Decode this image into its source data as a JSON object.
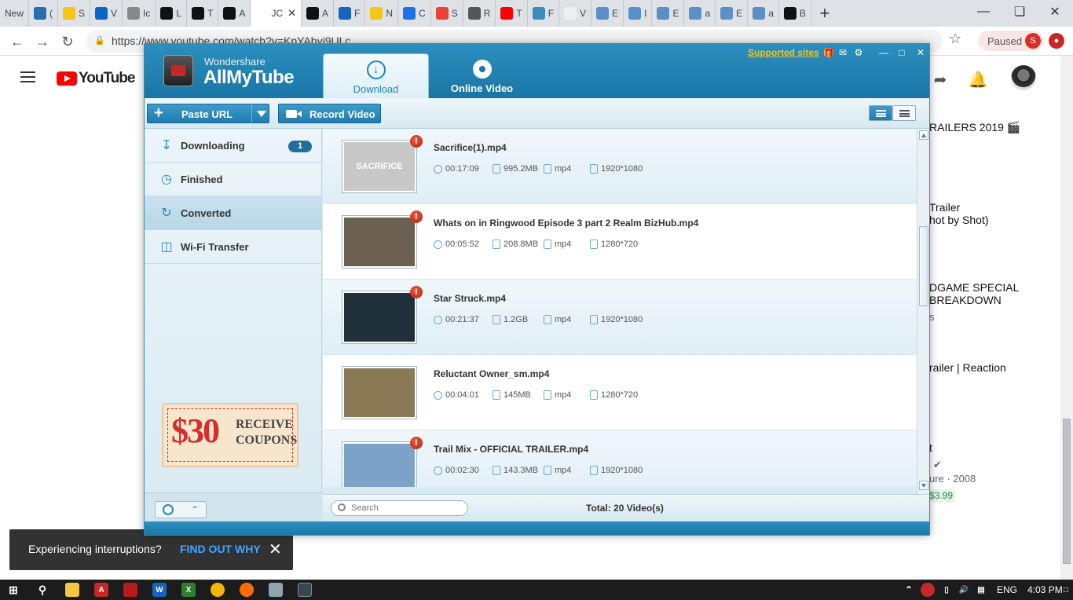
{
  "browser": {
    "tabs": [
      {
        "label": "New",
        "icon": "new-tab-icon",
        "color": "#dee1e6"
      },
      {
        "label": "(",
        "icon": "globe-icon",
        "color": "#2b6cb0"
      },
      {
        "label": "S",
        "icon": "imdb-icon",
        "color": "#f5c518"
      },
      {
        "label": "V",
        "icon": "linkedin-icon",
        "color": "#0a66c2"
      },
      {
        "label": "Ic",
        "icon": "doc-icon",
        "color": "#888888"
      },
      {
        "label": "L",
        "icon": "a-icon",
        "color": "#111111"
      },
      {
        "label": "T",
        "icon": "a-icon",
        "color": "#111111"
      },
      {
        "label": "A",
        "icon": "a-icon",
        "color": "#111111"
      },
      {
        "label": "JC",
        "icon": "jc-icon",
        "color": "#ffffff",
        "active": true
      },
      {
        "label": "A",
        "icon": "a-icon",
        "color": "#111111"
      },
      {
        "label": "F",
        "icon": "f-icon",
        "color": "#1565c0"
      },
      {
        "label": "N",
        "icon": "pencil-icon",
        "color": "#f5c518"
      },
      {
        "label": "C",
        "icon": "calendar-icon",
        "color": "#1a73e8"
      },
      {
        "label": "S",
        "icon": "google-icon",
        "color": "#ea4335"
      },
      {
        "label": "R",
        "icon": "wikipedia-icon",
        "color": "#555555"
      },
      {
        "label": "T",
        "icon": "youtube-icon",
        "color": "#ff0000"
      },
      {
        "label": "F",
        "icon": "puzzle-icon",
        "color": "#3c8dbc"
      },
      {
        "label": "V",
        "icon": "plesk-icon",
        "color": "#eeeeee"
      },
      {
        "label": "E",
        "icon": "wo-icon",
        "color": "#5b8fc7"
      },
      {
        "label": "I",
        "icon": "wo-icon",
        "color": "#5b8fc7"
      },
      {
        "label": "E",
        "icon": "wo-icon",
        "color": "#5b8fc7"
      },
      {
        "label": "a",
        "icon": "wo-icon",
        "color": "#5b8fc7"
      },
      {
        "label": "E",
        "icon": "wo-icon",
        "color": "#5b8fc7"
      },
      {
        "label": "a",
        "icon": "wo-icon",
        "color": "#5b8fc7"
      },
      {
        "label": "B",
        "icon": "bbc-icon",
        "color": "#111111"
      }
    ],
    "url": "https://www.youtube.com/watch?v=KpYAbyj9ULc",
    "paused_label": "Paused",
    "profile_initial": "S"
  },
  "youtube": {
    "logo_text": "YouTube",
    "sidebar_snippets": [
      {
        "text": "RAILERS 2019 🎬",
        "kind": "title"
      },
      {
        "text": "Trailer",
        "kind": "title"
      },
      {
        "text": "hot by Shot)",
        "kind": "title"
      },
      {
        "text": "DGAME SPECIAL",
        "kind": "title"
      },
      {
        "text": "BREAKDOWN",
        "kind": "title"
      },
      {
        "text": "s",
        "kind": "meta"
      },
      {
        "text": "railer | Reaction",
        "kind": "title"
      },
      {
        "text": "t",
        "kind": "title"
      },
      {
        "text": "ure · 2008",
        "kind": "meta"
      },
      {
        "text": "$3.99",
        "kind": "price"
      }
    ],
    "toast": {
      "message": "Experiencing interruptions?",
      "link": "FIND OUT WHY"
    }
  },
  "app": {
    "brand_small": "Wondershare",
    "brand_big": "AllMyTube",
    "tabs": {
      "download": "Download",
      "online": "Online Video"
    },
    "supported_sites": "Supported sites",
    "toolbar": {
      "paste_url": "Paste URL",
      "record_video": "Record Video"
    },
    "nav": [
      {
        "label": "Downloading",
        "badge": "1"
      },
      {
        "label": "Finished"
      },
      {
        "label": "Converted",
        "active": true
      },
      {
        "label": "Wi-Fi Transfer"
      }
    ],
    "coupon": {
      "amount": "$30",
      "text": "RECEIVE COUPONS"
    },
    "videos": [
      {
        "title": "Sacrifice(1).mp4",
        "duration": "00:17:09",
        "size": "995.2MB",
        "format": "mp4",
        "resolution": "1920*1080",
        "thumb_text": "SACRIFICE",
        "thumb_color": "#c8c8c8",
        "warn": true
      },
      {
        "title": "Whats on in Ringwood Episode 3 part 2 Realm BizHub.mp4",
        "duration": "00:05:52",
        "size": "208.8MB",
        "format": "mp4",
        "resolution": "1280*720",
        "thumb_text": "",
        "thumb_color": "#6b6052",
        "warn": true
      },
      {
        "title": "Star Struck.mp4",
        "duration": "00:21:37",
        "size": "1.2GB",
        "format": "mp4",
        "resolution": "1920*1080",
        "thumb_text": "",
        "thumb_color": "#20303a",
        "warn": true
      },
      {
        "title": "Reluctant Owner_sm.mp4",
        "duration": "00:04:01",
        "size": "145MB",
        "format": "mp4",
        "resolution": "1280*720",
        "thumb_text": "",
        "thumb_color": "#8a7a55",
        "warn": false
      },
      {
        "title": "Trail Mix - OFFICIAL TRAILER.mp4",
        "duration": "00:02:30",
        "size": "143.3MB",
        "format": "mp4",
        "resolution": "1920*1080",
        "thumb_text": "",
        "thumb_color": "#7da2c8",
        "warn": true
      }
    ],
    "search_placeholder": "Search",
    "total": "Total: 20 Video(s)"
  },
  "taskbar": {
    "language": "ENG",
    "time": "4:03 PM"
  }
}
